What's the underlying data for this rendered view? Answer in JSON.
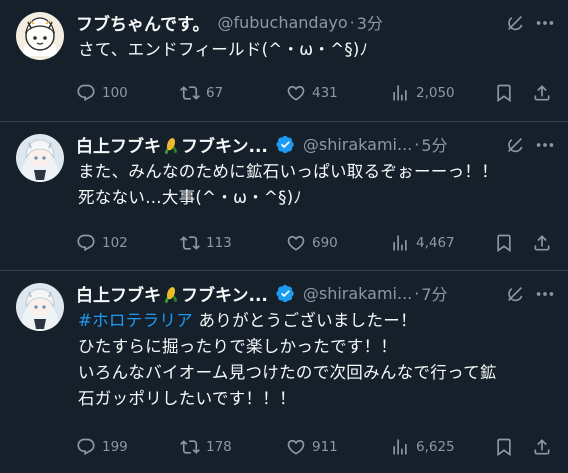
{
  "tweets": [
    {
      "name": "フブちゃんです。",
      "handle": "@fubuchandayo",
      "separator": "·",
      "time": "3分",
      "text": "さて、エンドフィールド(^・ω・^§)ﾉ",
      "replies": "100",
      "reposts": "67",
      "likes": "431",
      "views": "2,050"
    },
    {
      "name_part1": "白上フブキ",
      "name_part2": "フブキン...",
      "handle": "@shirakami...",
      "separator": "·",
      "time": "5分",
      "text": "また、みんなのために鉱石いっぱい取るぞぉーーっ！！\n死なない...大事(^・ω・^§)ﾉ",
      "replies": "102",
      "reposts": "113",
      "likes": "690",
      "views": "4,467"
    },
    {
      "name_part1": "白上フブキ",
      "name_part2": "フブキン...",
      "handle": "@shirakami...",
      "separator": "·",
      "time": "7分",
      "hashtag": "#ホロテラリア",
      "text_after_hashtag": " ありがとうございましたー！\nひたすらに掘ったりで楽しかったです！！\nいろんなバイオーム見つけたので次回みんなで行って鉱\n石ガッポリしたいです！！！",
      "replies": "199",
      "reposts": "178",
      "likes": "911",
      "views": "6,625"
    }
  ],
  "icons": {
    "grok": "grok-icon",
    "more": "more-icon",
    "reply": "reply-icon",
    "repost": "repost-icon",
    "like": "heart-icon",
    "views": "views-icon",
    "bookmark": "bookmark-icon",
    "share": "share-icon",
    "verified": "verified-badge-icon",
    "emoji": "corn-emoji"
  },
  "colors": {
    "background": "#15202b",
    "text": "#f7f9f9",
    "secondary": "#8b98a5",
    "accent": "#1d9bf0",
    "divider": "#38444d"
  }
}
